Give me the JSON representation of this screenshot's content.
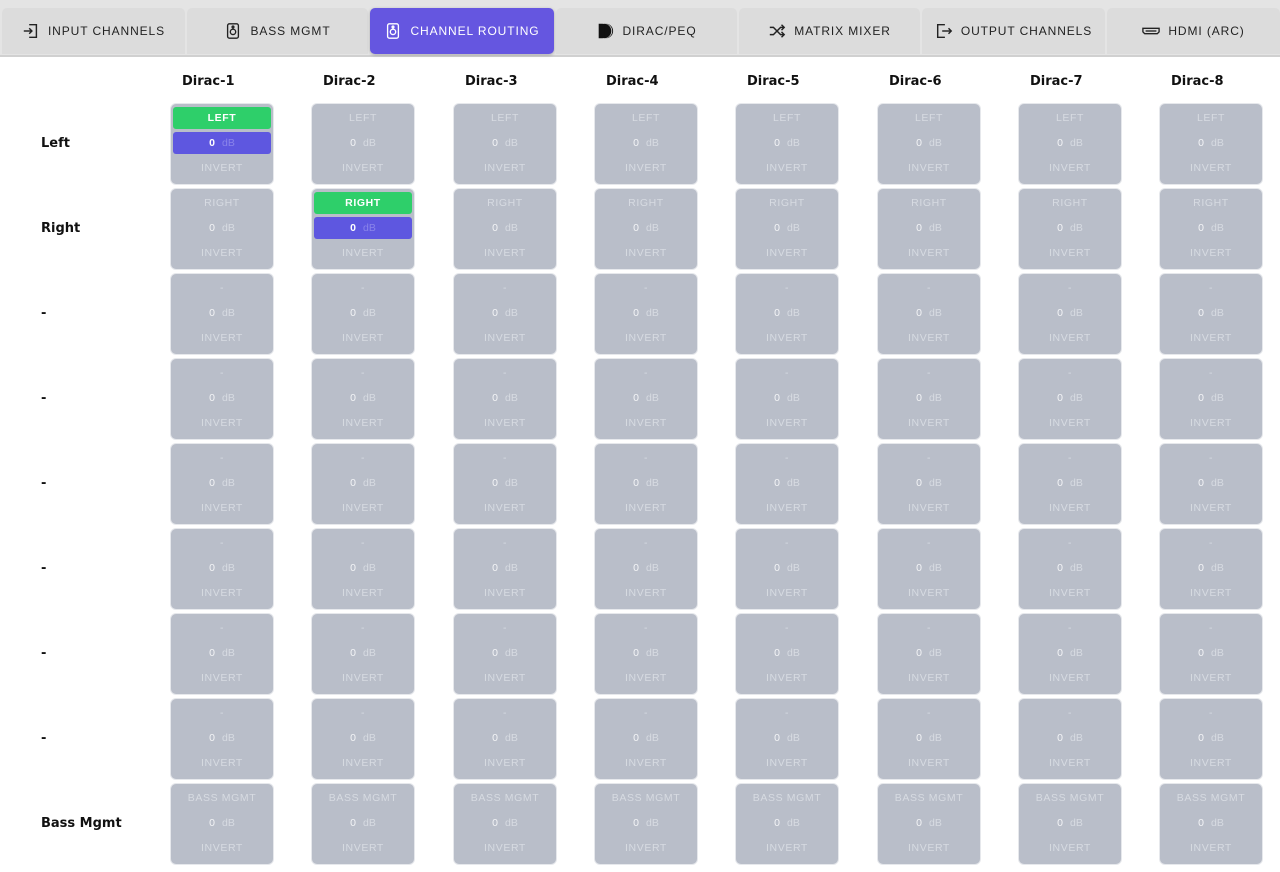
{
  "tabs": [
    {
      "label": "INPUT CHANNELS",
      "icon": "input-icon",
      "active": false
    },
    {
      "label": "BASS MGMT",
      "icon": "speaker-icon",
      "active": false
    },
    {
      "label": "CHANNEL ROUTING",
      "icon": "speaker-icon",
      "active": true
    },
    {
      "label": "DIRAC/PEQ",
      "icon": "dirac-icon",
      "active": false
    },
    {
      "label": "MATRIX MIXER",
      "icon": "shuffle-icon",
      "active": false
    },
    {
      "label": "OUTPUT CHANNELS",
      "icon": "output-icon",
      "active": false
    },
    {
      "label": "HDMI (ARC)",
      "icon": "hdmi-icon",
      "active": false
    }
  ],
  "columns": [
    "Dirac-1",
    "Dirac-2",
    "Dirac-3",
    "Dirac-4",
    "Dirac-5",
    "Dirac-6",
    "Dirac-7",
    "Dirac-8"
  ],
  "rows": [
    {
      "label": "Left",
      "source": "LEFT"
    },
    {
      "label": "Right",
      "source": "RIGHT"
    },
    {
      "label": "-",
      "source": "-"
    },
    {
      "label": "-",
      "source": "-"
    },
    {
      "label": "-",
      "source": "-"
    },
    {
      "label": "-",
      "source": "-"
    },
    {
      "label": "-",
      "source": "-"
    },
    {
      "label": "-",
      "source": "-"
    },
    {
      "label": "Bass Mgmt",
      "source": "BASS MGMT"
    }
  ],
  "cell_defaults": {
    "gain": "0",
    "unit": "dB",
    "invert_label": "INVERT"
  },
  "active_routes": [
    {
      "row": 0,
      "col": 0
    },
    {
      "row": 1,
      "col": 1
    }
  ],
  "colors": {
    "accent": "#6556e0",
    "active_source": "#2ecf6a",
    "active_gain": "#5e57e0",
    "cell_inactive": "#b9bec9",
    "tab_bg": "#dcdcdc"
  }
}
